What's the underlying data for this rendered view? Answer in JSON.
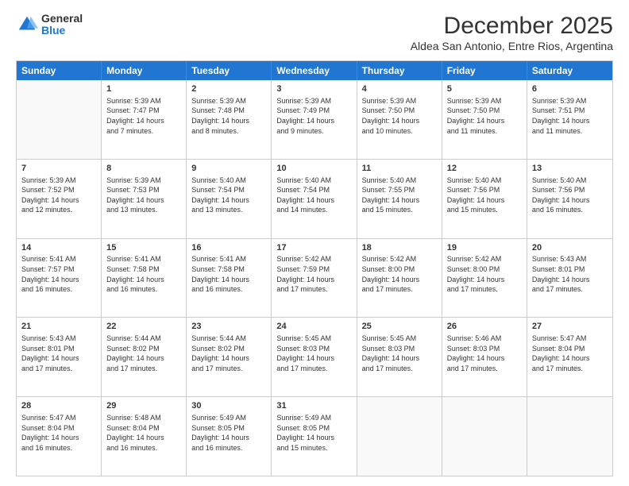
{
  "logo": {
    "general": "General",
    "blue": "Blue"
  },
  "header": {
    "month": "December 2025",
    "location": "Aldea San Antonio, Entre Rios, Argentina"
  },
  "weekdays": [
    "Sunday",
    "Monday",
    "Tuesday",
    "Wednesday",
    "Thursday",
    "Friday",
    "Saturday"
  ],
  "rows": [
    [
      {
        "day": "",
        "text": ""
      },
      {
        "day": "1",
        "text": "Sunrise: 5:39 AM\nSunset: 7:47 PM\nDaylight: 14 hours\nand 7 minutes."
      },
      {
        "day": "2",
        "text": "Sunrise: 5:39 AM\nSunset: 7:48 PM\nDaylight: 14 hours\nand 8 minutes."
      },
      {
        "day": "3",
        "text": "Sunrise: 5:39 AM\nSunset: 7:49 PM\nDaylight: 14 hours\nand 9 minutes."
      },
      {
        "day": "4",
        "text": "Sunrise: 5:39 AM\nSunset: 7:50 PM\nDaylight: 14 hours\nand 10 minutes."
      },
      {
        "day": "5",
        "text": "Sunrise: 5:39 AM\nSunset: 7:50 PM\nDaylight: 14 hours\nand 11 minutes."
      },
      {
        "day": "6",
        "text": "Sunrise: 5:39 AM\nSunset: 7:51 PM\nDaylight: 14 hours\nand 11 minutes."
      }
    ],
    [
      {
        "day": "7",
        "text": "Sunrise: 5:39 AM\nSunset: 7:52 PM\nDaylight: 14 hours\nand 12 minutes."
      },
      {
        "day": "8",
        "text": "Sunrise: 5:39 AM\nSunset: 7:53 PM\nDaylight: 14 hours\nand 13 minutes."
      },
      {
        "day": "9",
        "text": "Sunrise: 5:40 AM\nSunset: 7:54 PM\nDaylight: 14 hours\nand 13 minutes."
      },
      {
        "day": "10",
        "text": "Sunrise: 5:40 AM\nSunset: 7:54 PM\nDaylight: 14 hours\nand 14 minutes."
      },
      {
        "day": "11",
        "text": "Sunrise: 5:40 AM\nSunset: 7:55 PM\nDaylight: 14 hours\nand 15 minutes."
      },
      {
        "day": "12",
        "text": "Sunrise: 5:40 AM\nSunset: 7:56 PM\nDaylight: 14 hours\nand 15 minutes."
      },
      {
        "day": "13",
        "text": "Sunrise: 5:40 AM\nSunset: 7:56 PM\nDaylight: 14 hours\nand 16 minutes."
      }
    ],
    [
      {
        "day": "14",
        "text": "Sunrise: 5:41 AM\nSunset: 7:57 PM\nDaylight: 14 hours\nand 16 minutes."
      },
      {
        "day": "15",
        "text": "Sunrise: 5:41 AM\nSunset: 7:58 PM\nDaylight: 14 hours\nand 16 minutes."
      },
      {
        "day": "16",
        "text": "Sunrise: 5:41 AM\nSunset: 7:58 PM\nDaylight: 14 hours\nand 16 minutes."
      },
      {
        "day": "17",
        "text": "Sunrise: 5:42 AM\nSunset: 7:59 PM\nDaylight: 14 hours\nand 17 minutes."
      },
      {
        "day": "18",
        "text": "Sunrise: 5:42 AM\nSunset: 8:00 PM\nDaylight: 14 hours\nand 17 minutes."
      },
      {
        "day": "19",
        "text": "Sunrise: 5:42 AM\nSunset: 8:00 PM\nDaylight: 14 hours\nand 17 minutes."
      },
      {
        "day": "20",
        "text": "Sunrise: 5:43 AM\nSunset: 8:01 PM\nDaylight: 14 hours\nand 17 minutes."
      }
    ],
    [
      {
        "day": "21",
        "text": "Sunrise: 5:43 AM\nSunset: 8:01 PM\nDaylight: 14 hours\nand 17 minutes."
      },
      {
        "day": "22",
        "text": "Sunrise: 5:44 AM\nSunset: 8:02 PM\nDaylight: 14 hours\nand 17 minutes."
      },
      {
        "day": "23",
        "text": "Sunrise: 5:44 AM\nSunset: 8:02 PM\nDaylight: 14 hours\nand 17 minutes."
      },
      {
        "day": "24",
        "text": "Sunrise: 5:45 AM\nSunset: 8:03 PM\nDaylight: 14 hours\nand 17 minutes."
      },
      {
        "day": "25",
        "text": "Sunrise: 5:45 AM\nSunset: 8:03 PM\nDaylight: 14 hours\nand 17 minutes."
      },
      {
        "day": "26",
        "text": "Sunrise: 5:46 AM\nSunset: 8:03 PM\nDaylight: 14 hours\nand 17 minutes."
      },
      {
        "day": "27",
        "text": "Sunrise: 5:47 AM\nSunset: 8:04 PM\nDaylight: 14 hours\nand 17 minutes."
      }
    ],
    [
      {
        "day": "28",
        "text": "Sunrise: 5:47 AM\nSunset: 8:04 PM\nDaylight: 14 hours\nand 16 minutes."
      },
      {
        "day": "29",
        "text": "Sunrise: 5:48 AM\nSunset: 8:04 PM\nDaylight: 14 hours\nand 16 minutes."
      },
      {
        "day": "30",
        "text": "Sunrise: 5:49 AM\nSunset: 8:05 PM\nDaylight: 14 hours\nand 16 minutes."
      },
      {
        "day": "31",
        "text": "Sunrise: 5:49 AM\nSunset: 8:05 PM\nDaylight: 14 hours\nand 15 minutes."
      },
      {
        "day": "",
        "text": ""
      },
      {
        "day": "",
        "text": ""
      },
      {
        "day": "",
        "text": ""
      }
    ]
  ]
}
